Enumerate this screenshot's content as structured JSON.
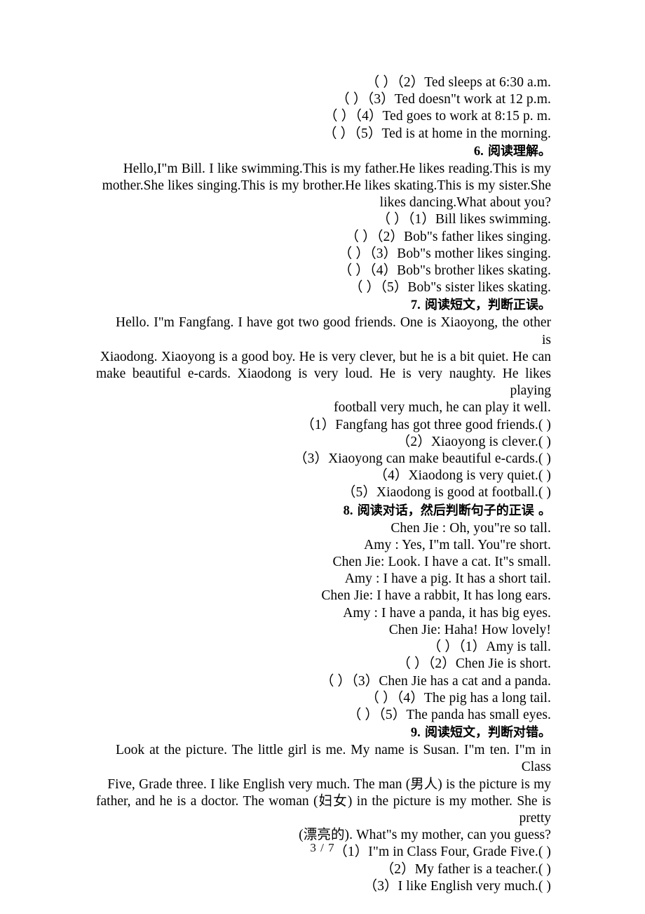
{
  "document": {
    "page_label": "3 / 7"
  },
  "blocks": {
    "ex5_items": [
      "（ ）（2）Ted sleeps at 6:30 a.m.",
      "（ ）（3）Ted doesn\"t work at 12 p.m.",
      "（ ）（4）Ted goes to work at 8:15 p. m.",
      "（ ）（5）Ted is at home in the morning."
    ],
    "ex6": {
      "number": "6.",
      "heading": "阅读理解。",
      "passage_lines": [
        "Hello,I\"m Bill. I like swimming.This is my father.He likes reading.This is my",
        "mother.She likes singing.This is my brother.He likes skating.This is my sister.She",
        "likes dancing.What about you?"
      ],
      "items": [
        "（ ）（1）Bill likes swimming.",
        "（ ）（2）Bob\"s father likes singing.",
        "（ ）（3）Bob\"s mother likes singing.",
        "（ ）（4）Bob\"s brother likes skating.",
        "（ ）（5）Bob\"s sister likes skating."
      ]
    },
    "ex7": {
      "number": "7.",
      "heading": "阅读短文，判断正误。",
      "passage_lines": [
        "Hello. I\"m Fangfang. I have got two good friends. One is Xiaoyong, the other is",
        "Xiaodong. Xiaoyong is a good boy. He is very clever, but he is a bit quiet. He can",
        "make beautiful e-cards. Xiaodong is very loud. He is very naughty. He likes playing",
        "football very much, he can play it well."
      ],
      "items": [
        "（1）Fangfang has got three good friends.(  )",
        "（2）Xiaoyong is clever.(  )",
        "（3）Xiaoyong can make beautiful e-cards.(  )",
        "（4）Xiaodong is very quiet.(  )",
        "（5）Xiaodong is good at football.(  )"
      ]
    },
    "ex8": {
      "number": "8.",
      "heading": "阅读对话，然后判断句子的正误 。",
      "dialogue_lines": [
        "Chen Jie : Oh, you\"re so tall.",
        "Amy : Yes, I\"m tall. You\"re short.",
        "Chen Jie: Look. I have a cat. It\"s small.",
        "Amy : I have a pig. It has a short tail.",
        "Chen Jie: I have a rabbit, It has long ears.",
        "Amy : I have a panda, it has big eyes.",
        "Chen Jie: Haha! How lovely!"
      ],
      "items": [
        "（ ）（1）Amy is tall.",
        "（ ）（2）Chen Jie is short.",
        "（ ）（3）Chen Jie has a cat and a panda.",
        "（ ）（4）The pig has a long tail.",
        "（ ）（5）The panda has small eyes."
      ]
    },
    "ex9": {
      "number": "9.",
      "heading": "阅读短文，判断对错。",
      "passage_lines": [
        "Look at the picture. The little girl is me. My name is Susan. I\"m ten. I\"m in Class",
        "Five, Grade three. I like English very much. The man (男人) is the picture is my",
        "father, and he is a doctor. The woman (妇女) in the picture is my mother. She is pretty",
        "(漂亮的). What\"s my mother, can you guess?"
      ],
      "items": [
        "（1）I\"m in Class Four, Grade Five.(  )",
        "（2）My father is a teacher.(  )",
        "（3）I like English very much.(  )"
      ]
    }
  }
}
